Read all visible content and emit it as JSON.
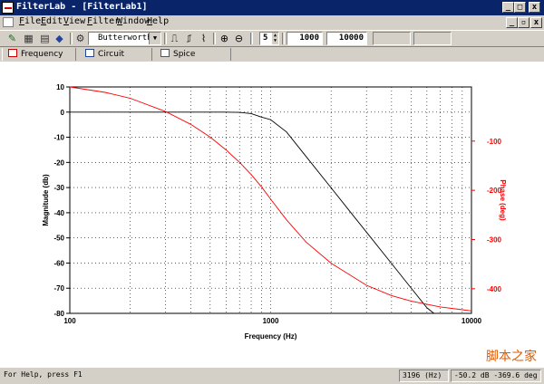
{
  "window": {
    "title": "FilterLab - [FilterLab1]",
    "minimize_glyph": "_",
    "maximize_glyph": "□",
    "close_glyph": "x",
    "restore_glyph": "▫"
  },
  "menu": {
    "items": [
      {
        "label": "File",
        "hotkey": "F"
      },
      {
        "label": "Edit",
        "hotkey": "E"
      },
      {
        "label": "View",
        "hotkey": "V"
      },
      {
        "label": "Filter",
        "hotkey": "F"
      },
      {
        "label": "Window",
        "hotkey": "W"
      },
      {
        "label": "Help",
        "hotkey": "H"
      }
    ]
  },
  "toolbar": {
    "filter_type": "Butterworth",
    "order": "5",
    "freq_start": "1000",
    "freq_stop": "10000",
    "icons": [
      "filter-design-icon",
      "filter-new-icon",
      "filter-params-icon",
      "filter-compare-icon",
      "wrench-icon",
      "lowpass-icon",
      "bandpass-icon",
      "highpass-icon",
      "zoom-in-icon",
      "zoom-out-icon"
    ]
  },
  "tabs": [
    {
      "label": "Frequency",
      "icon": "frequency-tab-icon",
      "active": true
    },
    {
      "label": "Circuit",
      "icon": "circuit-tab-icon",
      "active": false
    },
    {
      "label": "Spice",
      "icon": "spice-tab-icon",
      "active": false
    }
  ],
  "chart_data": {
    "type": "line",
    "xlabel": "Frequency (Hz)",
    "ylabel": "Magnitude (db)",
    "y2label": "Phase (deg)",
    "x_scale": "log",
    "xlim": [
      100,
      10000
    ],
    "ylim": [
      -80,
      10
    ],
    "y2lim": [
      -450,
      10
    ],
    "x_ticks": [
      "100",
      "1000",
      "10000"
    ],
    "y_ticks": [
      10,
      0,
      -10,
      -20,
      -30,
      -40,
      -50,
      -60,
      -70,
      -80
    ],
    "y2_ticks": [
      -100,
      -200,
      -300,
      -400
    ],
    "grid": true,
    "colors": {
      "magnitude": "#000000",
      "phase": "#ff0000"
    },
    "series": [
      {
        "axis": "left",
        "x": [
          100,
          200,
          300,
          400,
          500,
          600,
          700,
          800,
          900,
          1000,
          1200,
          1500,
          2000,
          2500,
          3000,
          4000,
          5000,
          6000,
          6500
        ],
        "y": [
          0,
          0,
          0,
          0,
          0,
          0,
          -0.1,
          -0.6,
          -2,
          -3,
          -7.9,
          -17.6,
          -30.1,
          -39.8,
          -47.7,
          -60.2,
          -69.9,
          -77.8,
          -80
        ]
      },
      {
        "axis": "right",
        "x": [
          100,
          150,
          200,
          300,
          400,
          500,
          600,
          700,
          800,
          900,
          1000,
          1200,
          1500,
          2000,
          3000,
          4000,
          5000,
          7000,
          10000
        ],
        "y": [
          10,
          -1,
          -13,
          -40,
          -66,
          -92,
          -118,
          -143,
          -168,
          -193,
          -218,
          -260,
          -305,
          -348,
          -393,
          -414,
          -425,
          -437,
          -445
        ]
      }
    ]
  },
  "status": {
    "help": "For Help, press F1",
    "frequency": "3196 (Hz)",
    "readout": "-50.2 dB -369.6 deg"
  },
  "watermark": "脚本之家"
}
